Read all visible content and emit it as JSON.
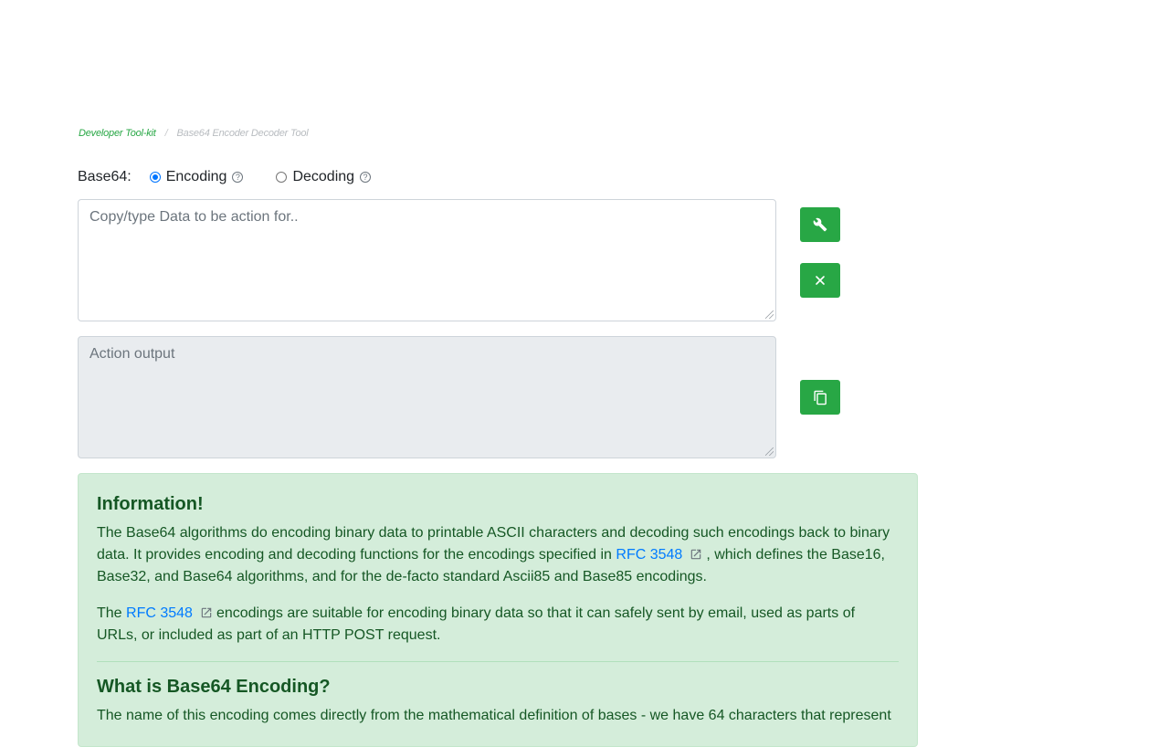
{
  "breadcrumb": {
    "home": "Developer Tool-kit",
    "current": "Base64 Encoder Decoder Tool"
  },
  "mode": {
    "label": "Base64:",
    "options": [
      {
        "label": "Encoding",
        "checked": true
      },
      {
        "label": "Decoding",
        "checked": false
      }
    ]
  },
  "input": {
    "placeholder": "Copy/type Data to be action for.."
  },
  "output": {
    "placeholder": "Action output"
  },
  "buttons": {
    "run_icon": "wrench-icon",
    "clear_icon": "close-icon",
    "copy_icon": "copy-icon"
  },
  "info": {
    "heading": "Information!",
    "p1_before": "The Base64 algorithms do encoding binary data to printable ASCII characters and decoding such encodings back to binary data. It provides encoding and decoding functions for the encodings specified in",
    "p1_link": "RFC 3548",
    "p1_after": ", which defines the Base16, Base32, and Base64 algorithms, and for the de-facto standard Ascii85 and Base85 encodings.",
    "p2_before": "The",
    "p2_link": "RFC 3548",
    "p2_after": "encodings are suitable for encoding binary data so that it can safely sent by email, used as parts of URLs, or included as part of an HTTP POST request.",
    "heading2": "What is Base64 Encoding?",
    "p3": "The name of this encoding comes directly from the mathematical definition of bases - we have 64 characters that represent"
  },
  "colors": {
    "accent": "#28a745",
    "link": "#007bff",
    "info_bg": "#d4edda",
    "info_text": "#155724"
  }
}
